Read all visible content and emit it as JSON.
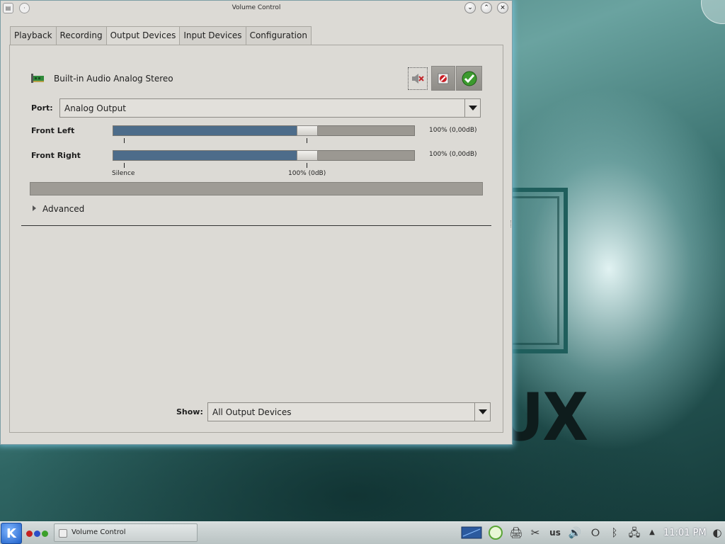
{
  "window": {
    "title": "Volume Control"
  },
  "tabs": [
    {
      "label": "Playback"
    },
    {
      "label": "Recording"
    },
    {
      "label": "Output Devices",
      "active": true
    },
    {
      "label": "Input Devices"
    },
    {
      "label": "Configuration"
    }
  ],
  "device": {
    "name": "Built-in Audio Analog Stereo",
    "port_label": "Port:",
    "port_value": "Analog Output",
    "channels": [
      {
        "name": "Front Left",
        "level_percent": 100,
        "value_text": "100% (0,00dB)"
      },
      {
        "name": "Front Right",
        "level_percent": 100,
        "value_text": "100% (0,00dB)"
      }
    ],
    "scale": {
      "silence": "Silence",
      "base": "100% (0dB)"
    },
    "advanced_label": "Advanced"
  },
  "footer": {
    "show_label": "Show:",
    "show_value": "All Output Devices"
  },
  "taskbar": {
    "task_label": "Volume Control",
    "keyboard_layout": "us",
    "clock": "11:01 PM"
  },
  "desktop": {
    "wallpaper_text": "UX"
  },
  "colors": {
    "slider_fill": "#4d6c8a",
    "window_bg": "#dcdad5",
    "accent_green": "#3c9a2e"
  }
}
